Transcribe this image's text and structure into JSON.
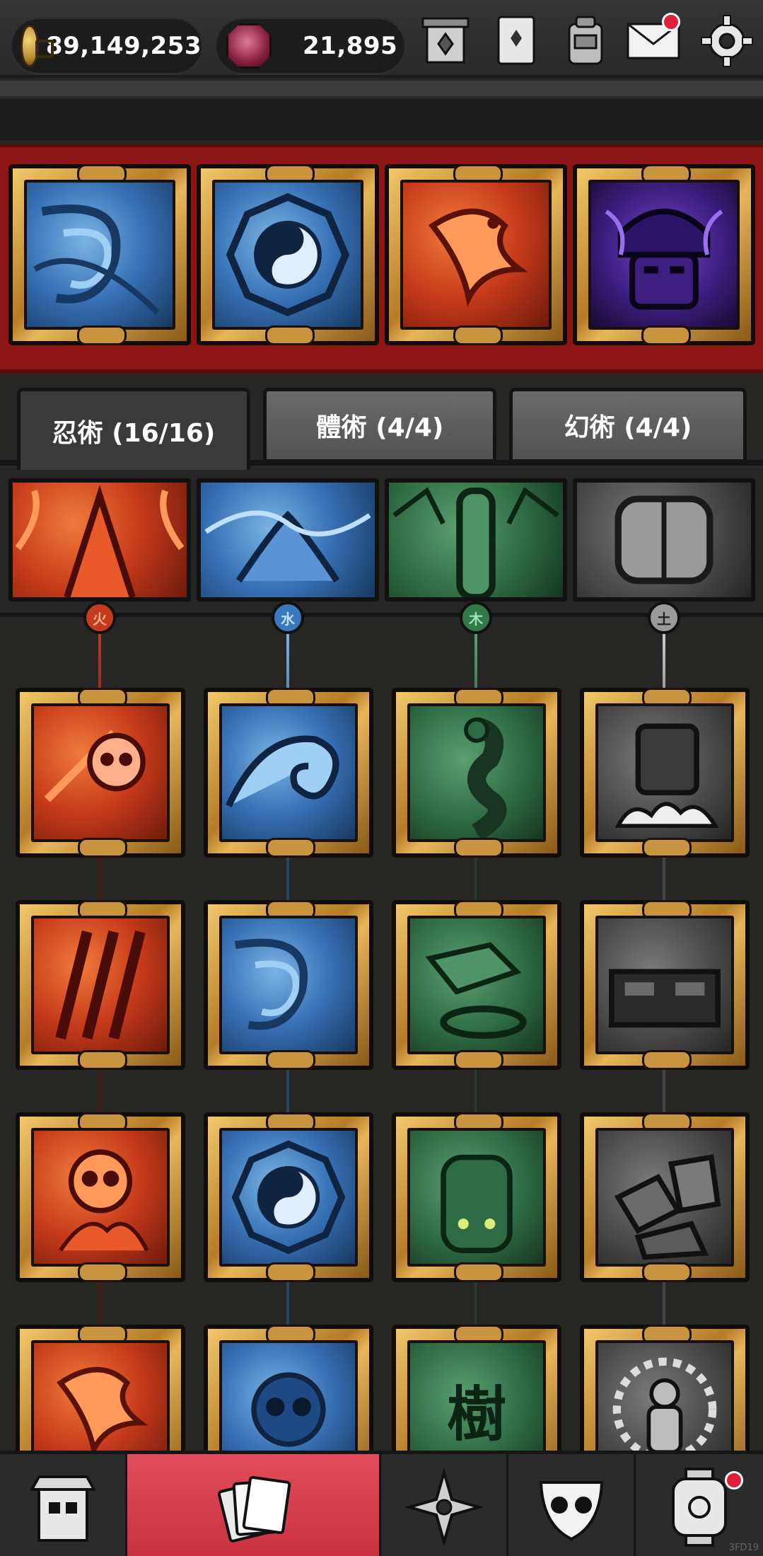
{
  "topbar": {
    "gold": "89,149,253",
    "gems": "21,895",
    "icons": [
      "shrine-icon",
      "scroll-icon",
      "backpack-icon",
      "mail-icon",
      "settings-icon"
    ]
  },
  "equipped": [
    {
      "element": "water",
      "motif": "swirl"
    },
    {
      "element": "water",
      "motif": "yin-yang"
    },
    {
      "element": "fire",
      "motif": "phoenix"
    },
    {
      "element": "shadow",
      "motif": "samurai-mask"
    }
  ],
  "tabs": [
    {
      "label": "忍術 (16/16)",
      "active": true
    },
    {
      "label": "體術 (4/4)",
      "active": false
    },
    {
      "label": "幻術 (4/4)",
      "active": false
    }
  ],
  "elements": [
    {
      "name": "fire",
      "glyph": "火",
      "color": "#c43a1e"
    },
    {
      "name": "water",
      "glyph": "水",
      "color": "#3a78c0"
    },
    {
      "name": "wood",
      "glyph": "木",
      "color": "#2f7a48"
    },
    {
      "name": "earth",
      "glyph": "土",
      "color": "#8a8a8a"
    }
  ],
  "skill_grid": [
    [
      "skull",
      "wave",
      "serpent",
      "rock-fist"
    ],
    [
      "claws",
      "swirl",
      "stone-wall",
      "stone-face"
    ],
    [
      "flaming-skull",
      "yin-yang",
      "golem",
      "boulders"
    ],
    [
      "phoenix",
      "skull-drip",
      "tree-kanji",
      "thousand-arm-statue"
    ]
  ],
  "tree_glyph": "樹",
  "nav": [
    "dojo-icon",
    "cards-icon",
    "shuriken-icon",
    "mask-icon",
    "lantern-icon"
  ],
  "watermark": "3FD19"
}
